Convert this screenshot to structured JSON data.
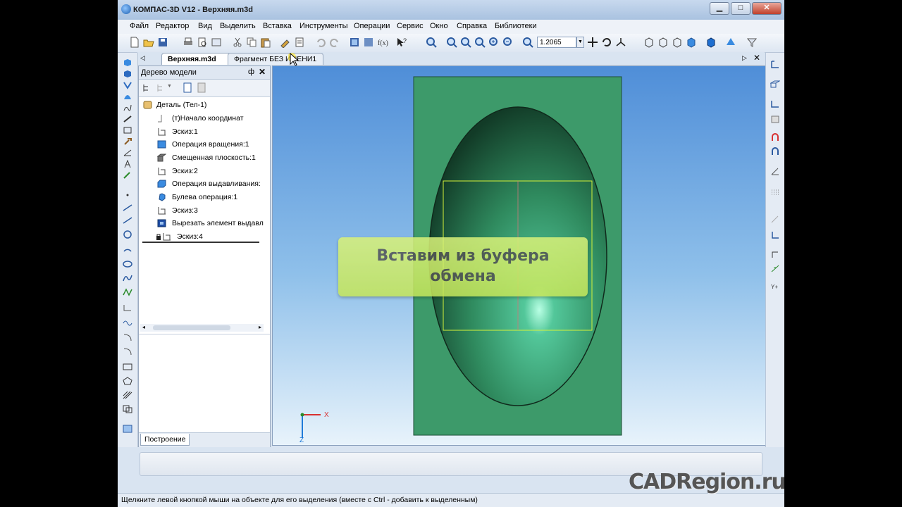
{
  "window": {
    "title": "КОМПАС-3D V12 - Верхняя.m3d",
    "buttons": {
      "minimize": "▁",
      "maximize": "□",
      "close": "✕"
    }
  },
  "menu": [
    "Файл",
    "Редактор",
    "Вид",
    "Выделить",
    "Вставка",
    "Инструменты",
    "Операции",
    "Сервис",
    "Окно",
    "Справка",
    "Библиотеки"
  ],
  "toolbar": {
    "zoom_value": "1.2065"
  },
  "doc_tabs": [
    {
      "label": "Верхняя.m3d",
      "active": true
    },
    {
      "label": "Фрагмент БЕЗ ИМЕНИ1",
      "active": false
    }
  ],
  "model_tree": {
    "title": "Дерево модели",
    "pin": "ф",
    "close": "✕",
    "items": [
      {
        "label": "Деталь (Тел-1)",
        "icon": "part-icon"
      },
      {
        "label": "(т)Начало координат",
        "icon": "origin-icon"
      },
      {
        "label": "Эскиз:1",
        "icon": "sketch-icon"
      },
      {
        "label": "Операция вращения:1",
        "icon": "rotation-icon"
      },
      {
        "label": "Смещенная плоскость:1",
        "icon": "plane-icon"
      },
      {
        "label": "Эскиз:2",
        "icon": "sketch-icon"
      },
      {
        "label": "Операция выдавливания:",
        "icon": "extrusion-icon"
      },
      {
        "label": "Булева операция:1",
        "icon": "boolean-icon"
      },
      {
        "label": "Эскиз:3",
        "icon": "sketch-icon"
      },
      {
        "label": "Вырезать элемент выдавл",
        "icon": "cut-icon"
      },
      {
        "label": "Эскиз:4",
        "icon": "sketch-icon"
      }
    ],
    "footer_tab": "Построение"
  },
  "viewport": {
    "callout_line1": "Вставим из буфера",
    "callout_line2": "обмена",
    "axis_x": "X",
    "axis_z": "Z",
    "colors": {
      "plate": "#3d9a6a",
      "sky_top": "#4f8ed8",
      "sky_bottom": "#e8f3fb",
      "sketch": "#d4f23a"
    }
  },
  "status_text": "Щелкните левой кнопкой мыши на объекте для его выделения (вместе с Ctrl - добавить к выделенным)",
  "watermark": "CADRegion.ru"
}
